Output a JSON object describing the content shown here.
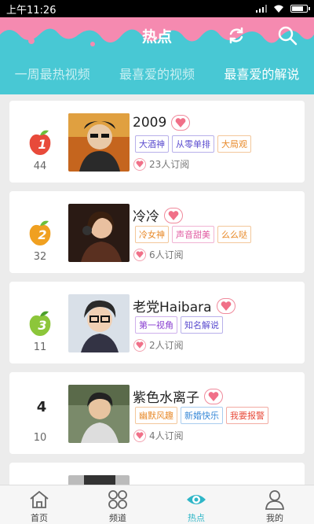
{
  "status": {
    "time": "上午11:26"
  },
  "header": {
    "title": "热点"
  },
  "tabs": [
    {
      "label": "一周最热视频",
      "active": false
    },
    {
      "label": "最喜爱的视频",
      "active": false
    },
    {
      "label": "最喜爱的解说",
      "active": true
    }
  ],
  "items": [
    {
      "rank": "1",
      "count": "44",
      "name": "2009",
      "tags": [
        "大酒神",
        "从零单排",
        "大局观"
      ],
      "tag_colors": [
        "#5b4ccf",
        "#5b4ccf",
        "#e88a2a"
      ],
      "subscribers": "23人订阅",
      "rank_color": "#e84a3a"
    },
    {
      "rank": "2",
      "count": "32",
      "name": "冷冷",
      "tags": [
        "冷女神",
        "声音甜美",
        "么么哒"
      ],
      "tag_colors": [
        "#e88a2a",
        "#e05aa0",
        "#e88a2a"
      ],
      "subscribers": "6人订阅",
      "rank_color": "#f0a020"
    },
    {
      "rank": "3",
      "count": "11",
      "name": "老党Haibara",
      "tags": [
        "第一视角",
        "知名解说"
      ],
      "tag_colors": [
        "#8a3fd0",
        "#5b4ccf"
      ],
      "subscribers": "2人订阅",
      "rank_color": "#8cc63a"
    },
    {
      "rank": "4",
      "count": "10",
      "name": "紫色水离子",
      "tags": [
        "幽默风趣",
        "新婚快乐",
        "我要报警"
      ],
      "tag_colors": [
        "#e88a2a",
        "#3a8ad8",
        "#e84a3a"
      ],
      "subscribers": "4人订阅",
      "rank_color": ""
    }
  ],
  "bottom_nav": [
    {
      "label": "首页",
      "icon": "home-icon",
      "active": false
    },
    {
      "label": "频道",
      "icon": "grid-icon",
      "active": false
    },
    {
      "label": "热点",
      "icon": "eye-icon",
      "active": true
    },
    {
      "label": "我的",
      "icon": "user-icon",
      "active": false
    }
  ],
  "colors": {
    "header": "#48c8d4",
    "drip": "#f58ab0",
    "accent": "#2fb6c7"
  }
}
